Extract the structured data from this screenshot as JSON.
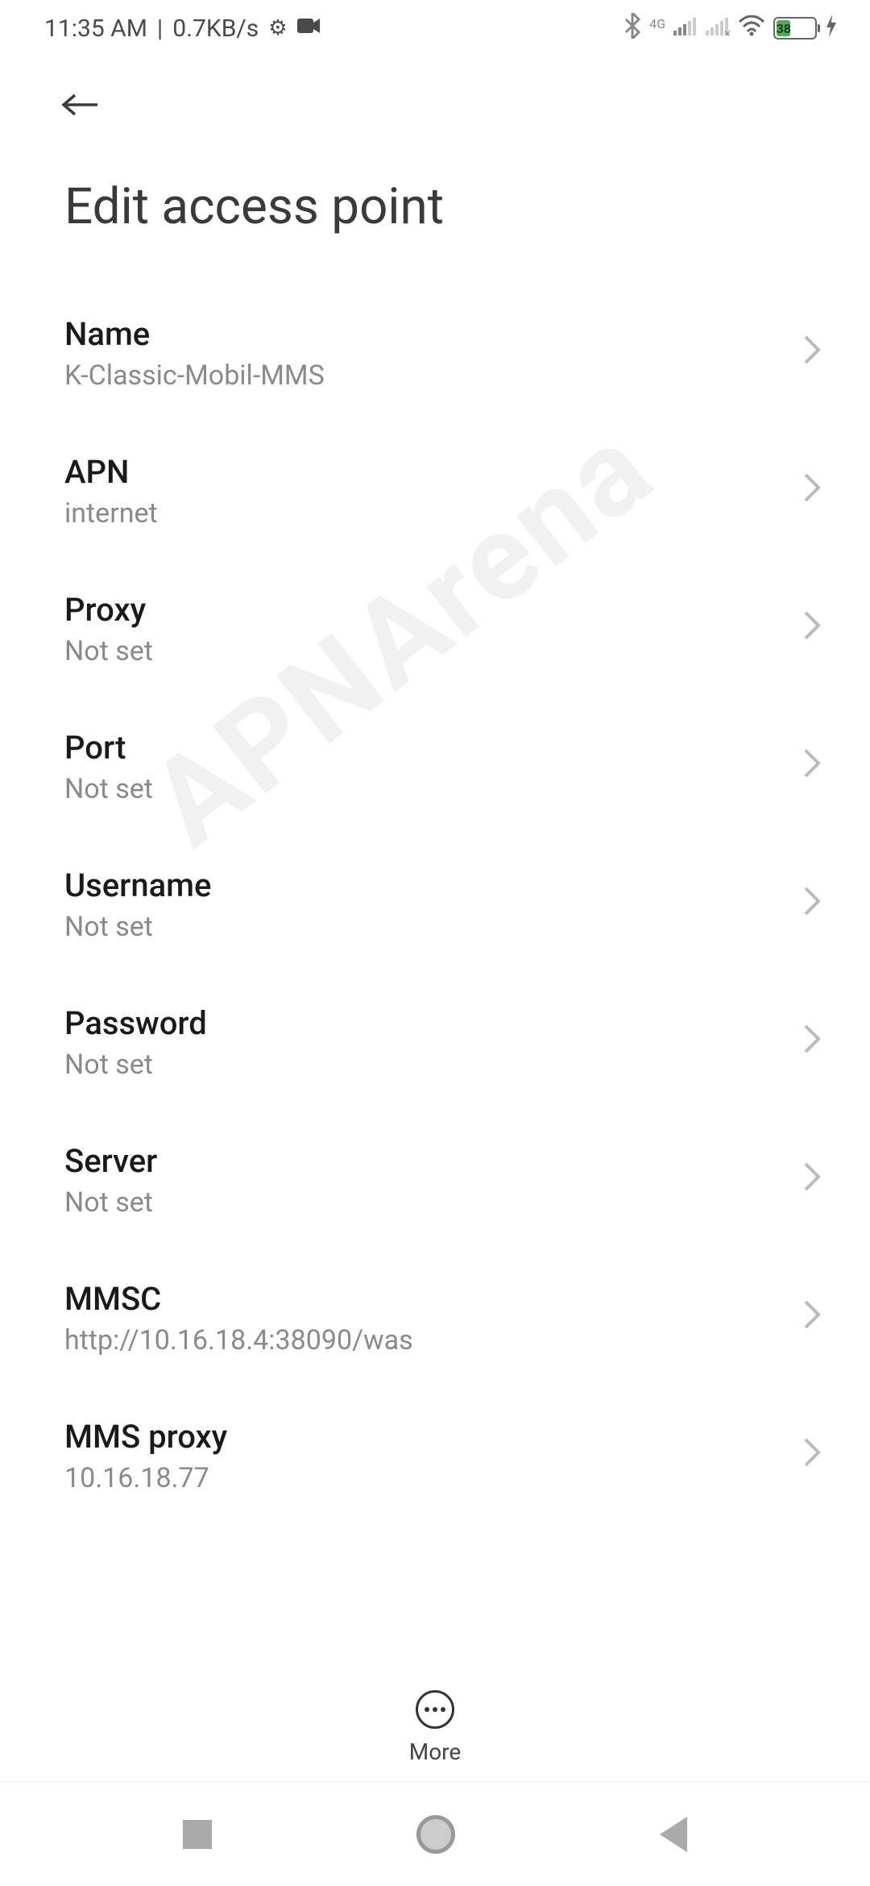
{
  "status": {
    "time": "11:35 AM",
    "separator": "|",
    "speed": "0.7KB/s",
    "network_label": "4G",
    "battery_percent": "38"
  },
  "header": {
    "title": "Edit access point"
  },
  "settings": [
    {
      "label": "Name",
      "value": "K-Classic-Mobil-MMS"
    },
    {
      "label": "APN",
      "value": "internet"
    },
    {
      "label": "Proxy",
      "value": "Not set"
    },
    {
      "label": "Port",
      "value": "Not set"
    },
    {
      "label": "Username",
      "value": "Not set"
    },
    {
      "label": "Password",
      "value": "Not set"
    },
    {
      "label": "Server",
      "value": "Not set"
    },
    {
      "label": "MMSC",
      "value": "http://10.16.18.4:38090/was"
    },
    {
      "label": "MMS proxy",
      "value": "10.16.18.77"
    }
  ],
  "bottom": {
    "more_label": "More"
  },
  "watermark": "APNArena"
}
